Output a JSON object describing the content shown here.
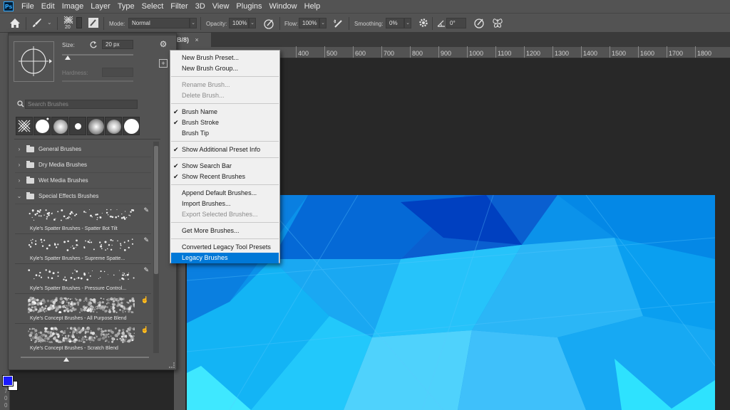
{
  "app": {
    "logo": "Ps"
  },
  "menubar": [
    "File",
    "Edit",
    "Image",
    "Layer",
    "Type",
    "Select",
    "Filter",
    "3D",
    "View",
    "Plugins",
    "Window",
    "Help"
  ],
  "options": {
    "brush_size": "20",
    "mode_label": "Mode:",
    "mode_value": "Normal",
    "opacity_label": "Opacity:",
    "opacity_value": "100%",
    "flow_label": "Flow:",
    "flow_value": "100%",
    "smoothing_label": "Smoothing:",
    "smoothing_value": "0%",
    "angle_value": "0°"
  },
  "document": {
    "tab_title": "B/8)",
    "close_glyph": "×"
  },
  "ruler": {
    "ticks": [
      "400",
      "500",
      "600",
      "700",
      "800",
      "900",
      "1000",
      "1100",
      "1200",
      "1300",
      "1400",
      "1500",
      "1600",
      "1700",
      "1800"
    ]
  },
  "toolbar": {
    "ruler_digits": [
      "7",
      "0",
      "0"
    ]
  },
  "brush_panel": {
    "size_label": "Size:",
    "size_value": "20 px",
    "size_fraction": 0.04,
    "hardness_label": "Hardness:",
    "search_placeholder": "Search Brushes",
    "groups": [
      {
        "label": "General Brushes",
        "expanded": false
      },
      {
        "label": "Dry Media Brushes",
        "expanded": false
      },
      {
        "label": "Wet Media Brushes",
        "expanded": false
      },
      {
        "label": "Special Effects Brushes",
        "expanded": true
      }
    ],
    "brushes": [
      "Kyle's Spatter Brushes - Spatter Bot Tilt",
      "Kyle's Spatter Brushes - Supreme Spatte...",
      "Kyle's Spatter Brushes - Pressure Control...",
      "Kyle's Concept Brushes - All Purpose Blend",
      "Kyle's Concept Brushes - Scratch Blend"
    ]
  },
  "flyout_menu": {
    "items": [
      {
        "label": "New Brush Preset...",
        "enabled": true,
        "checked": false,
        "selected": false
      },
      {
        "label": "New Brush Group...",
        "enabled": true,
        "checked": false,
        "selected": false
      },
      {
        "sep": true
      },
      {
        "label": "Rename Brush...",
        "enabled": false,
        "checked": false,
        "selected": false
      },
      {
        "label": "Delete Brush...",
        "enabled": false,
        "checked": false,
        "selected": false
      },
      {
        "sep": true
      },
      {
        "label": "Brush Name",
        "enabled": true,
        "checked": true,
        "selected": false
      },
      {
        "label": "Brush Stroke",
        "enabled": true,
        "checked": true,
        "selected": false
      },
      {
        "label": "Brush Tip",
        "enabled": true,
        "checked": false,
        "selected": false
      },
      {
        "sep": true
      },
      {
        "label": "Show Additional Preset Info",
        "enabled": true,
        "checked": true,
        "selected": false
      },
      {
        "sep": true
      },
      {
        "label": "Show Search Bar",
        "enabled": true,
        "checked": true,
        "selected": false
      },
      {
        "label": "Show Recent Brushes",
        "enabled": true,
        "checked": true,
        "selected": false
      },
      {
        "sep": true
      },
      {
        "label": "Append Default Brushes...",
        "enabled": true,
        "checked": false,
        "selected": false
      },
      {
        "label": "Import Brushes...",
        "enabled": true,
        "checked": false,
        "selected": false
      },
      {
        "label": "Export Selected Brushes...",
        "enabled": false,
        "checked": false,
        "selected": false
      },
      {
        "sep": true
      },
      {
        "label": "Get More Brushes...",
        "enabled": true,
        "checked": false,
        "selected": false
      },
      {
        "sep": true
      },
      {
        "label": "Converted Legacy Tool Presets",
        "enabled": true,
        "checked": false,
        "selected": false
      },
      {
        "label": "Legacy Brushes",
        "enabled": true,
        "checked": false,
        "selected": true
      }
    ],
    "check_glyph": "✔"
  },
  "colors": {
    "foreground": "#1a1aff",
    "background": "#ffffff",
    "menu_highlight": "#0078d7"
  }
}
